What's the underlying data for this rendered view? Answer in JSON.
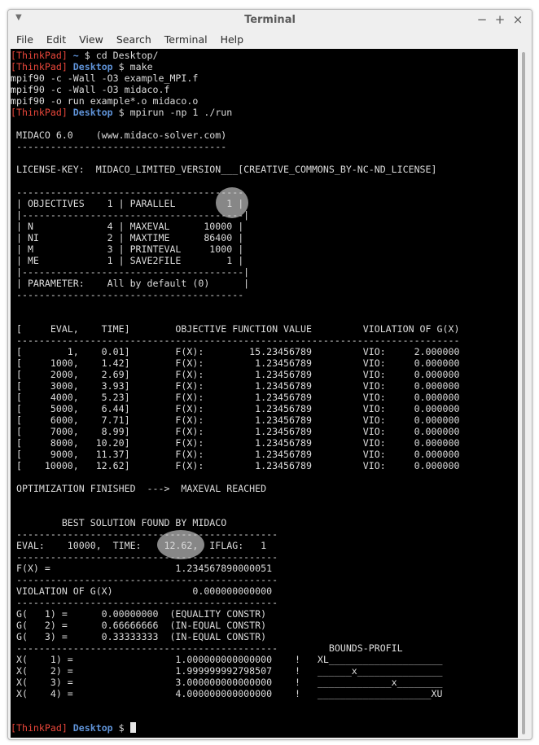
{
  "window": {
    "title": "Terminal",
    "menu": [
      "File",
      "Edit",
      "View",
      "Search",
      "Terminal",
      "Help"
    ],
    "controls": {
      "minimize": "−",
      "maximize": "+",
      "close": "×"
    },
    "menu_arrow": "▼"
  },
  "colors": {
    "terminal_bg": "#000000",
    "text": "#dcdcdc",
    "user": "#e8463a",
    "dir": "#5f93d8"
  },
  "terminal": {
    "lines": [
      {
        "user": "[ThinkPad]",
        "dir": "~",
        "sep": " $ ",
        "cmd": "cd Desktop/"
      },
      {
        "user": "[ThinkPad]",
        "dir": "Desktop",
        "sep": " $ ",
        "cmd": "make"
      },
      {
        "text": "mpif90 -c -Wall -O3 example_MPI.f"
      },
      {
        "text": "mpif90 -c -Wall -O3 midaco.f"
      },
      {
        "text": "mpif90 -o run example*.o midaco.o"
      },
      {
        "user": "[ThinkPad]",
        "dir": "Desktop",
        "sep": " $ ",
        "cmd": "mpirun -np 1 ./run"
      },
      {
        "text": ""
      },
      {
        "text": " MIDACO 6.0    (www.midaco-solver.com)"
      },
      {
        "text": " -------------------------------------"
      },
      {
        "text": ""
      },
      {
        "text": " LICENSE-KEY:  MIDACO_LIMITED_VERSION___[CREATIVE_COMMONS_BY-NC-ND_LICENSE]"
      },
      {
        "text": ""
      },
      {
        "text": " ----------------------------------------"
      },
      {
        "text": " | OBJECTIVES    1 | PARALLEL         1 |"
      },
      {
        "text": " |---------------------------------------|"
      },
      {
        "text": " | N             4 | MAXEVAL      10000 |"
      },
      {
        "text": " | NI            2 | MAXTIME      86400 |"
      },
      {
        "text": " | M             3 | PRINTEVAL     1000 |"
      },
      {
        "text": " | ME            1 | SAVE2FILE        1 |"
      },
      {
        "text": " |---------------------------------------|"
      },
      {
        "text": " | PARAMETER:    All by default (0)      |"
      },
      {
        "text": " ----------------------------------------"
      },
      {
        "text": ""
      },
      {
        "text": ""
      },
      {
        "text": " [     EVAL,    TIME]        OBJECTIVE FUNCTION VALUE         VIOLATION OF G(X)"
      },
      {
        "text": " ------------------------------------------------------------------------------"
      },
      {
        "text": " [        1,    0.01]        F(X):        15.23456789         VIO:     2.000000"
      },
      {
        "text": " [     1000,    1.42]        F(X):         1.23456789         VIO:     0.000000"
      },
      {
        "text": " [     2000,    2.69]        F(X):         1.23456789         VIO:     0.000000"
      },
      {
        "text": " [     3000,    3.93]        F(X):         1.23456789         VIO:     0.000000"
      },
      {
        "text": " [     4000,    5.23]        F(X):         1.23456789         VIO:     0.000000"
      },
      {
        "text": " [     5000,    6.44]        F(X):         1.23456789         VIO:     0.000000"
      },
      {
        "text": " [     6000,    7.71]        F(X):         1.23456789         VIO:     0.000000"
      },
      {
        "text": " [     7000,    8.99]        F(X):         1.23456789         VIO:     0.000000"
      },
      {
        "text": " [     8000,   10.20]        F(X):         1.23456789         VIO:     0.000000"
      },
      {
        "text": " [     9000,   11.37]        F(X):         1.23456789         VIO:     0.000000"
      },
      {
        "text": " [    10000,   12.62]        F(X):         1.23456789         VIO:     0.000000"
      },
      {
        "text": ""
      },
      {
        "text": " OPTIMIZATION FINISHED  --->  MAXEVAL REACHED"
      },
      {
        "text": ""
      },
      {
        "text": ""
      },
      {
        "text": "         BEST SOLUTION FOUND BY MIDACO"
      },
      {
        "text": " ----------------------------------------------"
      },
      {
        "text": " EVAL:    10000,  TIME:    12.62,  IFLAG:   1"
      },
      {
        "text": " ----------------------------------------------"
      },
      {
        "text": " F(X) =                      1.234567890000051"
      },
      {
        "text": " ----------------------------------------------"
      },
      {
        "text": " VIOLATION OF G(X)              0.000000000000"
      },
      {
        "text": " ----------------------------------------------"
      },
      {
        "text": " G(   1) =      0.00000000  (EQUALITY CONSTR)"
      },
      {
        "text": " G(   2) =      0.66666666  (IN-EQUAL CONSTR)"
      },
      {
        "text": " G(   3) =      0.33333333  (IN-EQUAL CONSTR)"
      },
      {
        "text": " ----------------------------------------------         BOUNDS-PROFIL"
      },
      {
        "text": " X(    1) =                  1.000000000000000    !   XL____________________"
      },
      {
        "text": " X(    2) =                  1.999999992798507    !   ______x_______________"
      },
      {
        "text": " X(    3) =                  3.000000000000000    !   _____________x________"
      },
      {
        "text": " X(    4) =                  4.000000000000000    !   ____________________XU"
      },
      {
        "text": ""
      },
      {
        "text": ""
      },
      {
        "user": "[ThinkPad]",
        "dir": "Desktop",
        "sep": " $ ",
        "cmd": "",
        "cursor": true
      }
    ]
  }
}
